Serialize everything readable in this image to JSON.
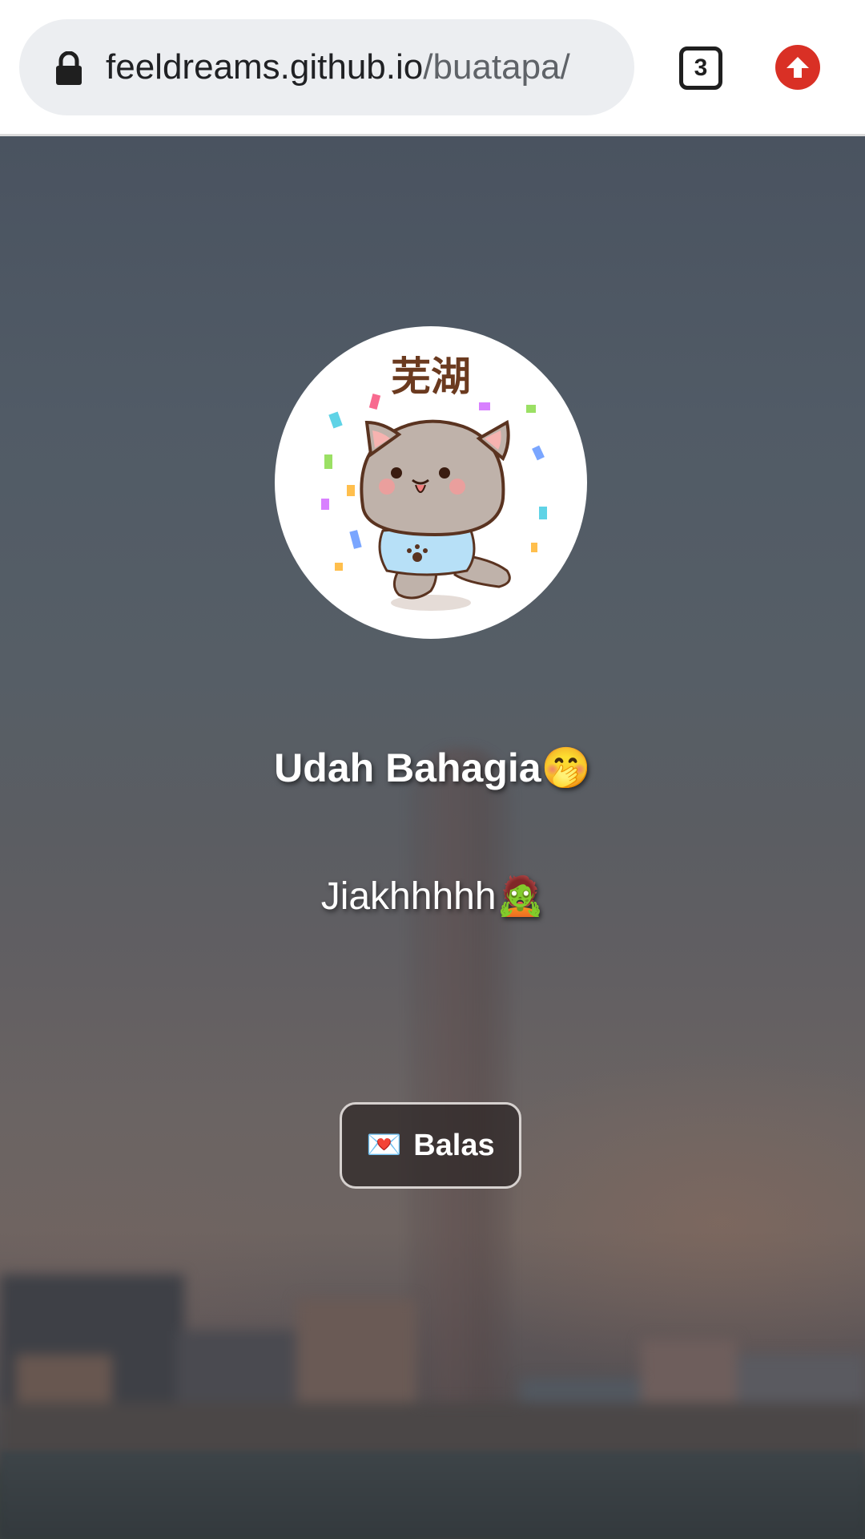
{
  "browser": {
    "url_host": "feeldreams.github.io",
    "url_path": "/buatapa/",
    "tab_count": "3",
    "icons": {
      "lock": "lock-icon",
      "update": "arrow-up-icon"
    },
    "colors": {
      "update_badge": "#d93025"
    }
  },
  "main": {
    "avatar_caption": "芜湖",
    "headline": "Udah Bahagia🤭",
    "subline": "Jiakhhhhh🧟",
    "reply_button": {
      "icon": "💌",
      "label": "Balas"
    }
  }
}
